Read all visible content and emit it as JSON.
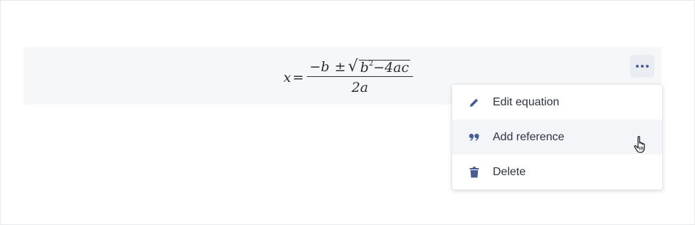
{
  "equation": {
    "lhs": "x",
    "equals": "=",
    "numerator_neg_b": "−b",
    "plus_minus": "±",
    "radicand_b": "b",
    "radicand_exp": "2",
    "radicand_rest": "−4ac",
    "denominator": "2a"
  },
  "toolbar": {
    "more_icon": "more-horizontal-icon"
  },
  "menu": {
    "items": [
      {
        "label": "Edit equation",
        "icon": "pencil-icon"
      },
      {
        "label": "Add reference",
        "icon": "quote-icon"
      },
      {
        "label": "Delete",
        "icon": "trash-icon"
      }
    ],
    "hovered_index": 1
  },
  "colors": {
    "accent_icon": "#4a5d8f",
    "block_bg": "#f6f7f9",
    "hover_bg": "#f3f5f8",
    "text": "#2d3340"
  }
}
